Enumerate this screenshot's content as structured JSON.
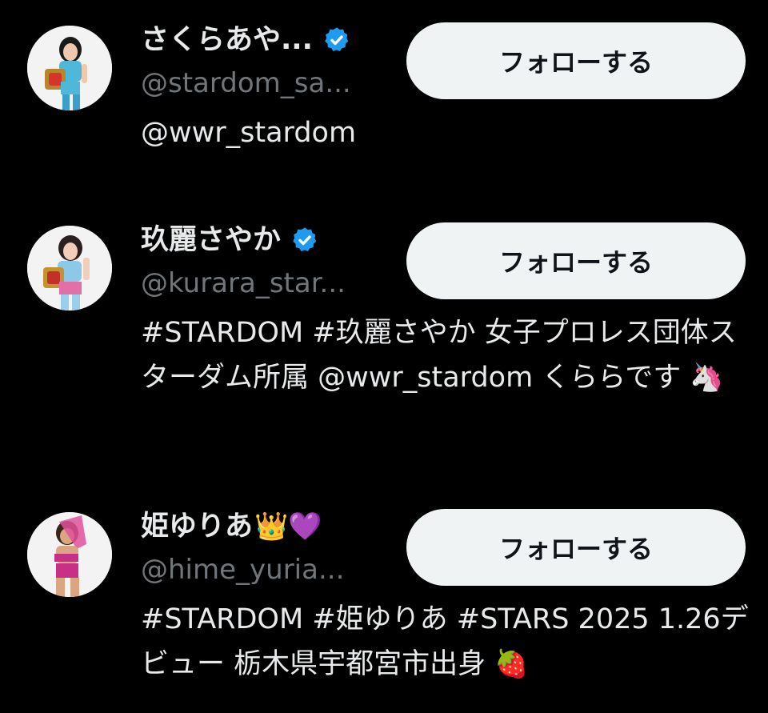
{
  "users": [
    {
      "display_name": "さくらあや...",
      "verified": true,
      "handle": "@stardom_sa...",
      "follow_label": "フォローする",
      "bio": "@wwr_stardom",
      "bio_emoji": ""
    },
    {
      "display_name": "玖麗さやか",
      "verified": true,
      "handle": "@kurara_star...",
      "follow_label": "フォローする",
      "bio": "#STARDOM #玖麗さやか 女子プロレス団体スターダム所属 @wwr_stardom くららです",
      "bio_emoji": "🦄"
    },
    {
      "display_name": "姫ゆりあ",
      "name_emoji": "👑💜",
      "verified": false,
      "handle": "@hime_yuria...",
      "follow_label": "フォローする",
      "bio": "#STARDOM #姫ゆりあ #STARS 2025 1.26デビュー 栃木県宇都宮市出身",
      "bio_emoji": "🍓"
    }
  ],
  "colors": {
    "background": "#000000",
    "primary_text": "#e7e9ea",
    "secondary_text": "#71767b",
    "button_bg": "#eff3f4",
    "button_text": "#0f1419",
    "verified_badge": "#1d9bf0"
  }
}
